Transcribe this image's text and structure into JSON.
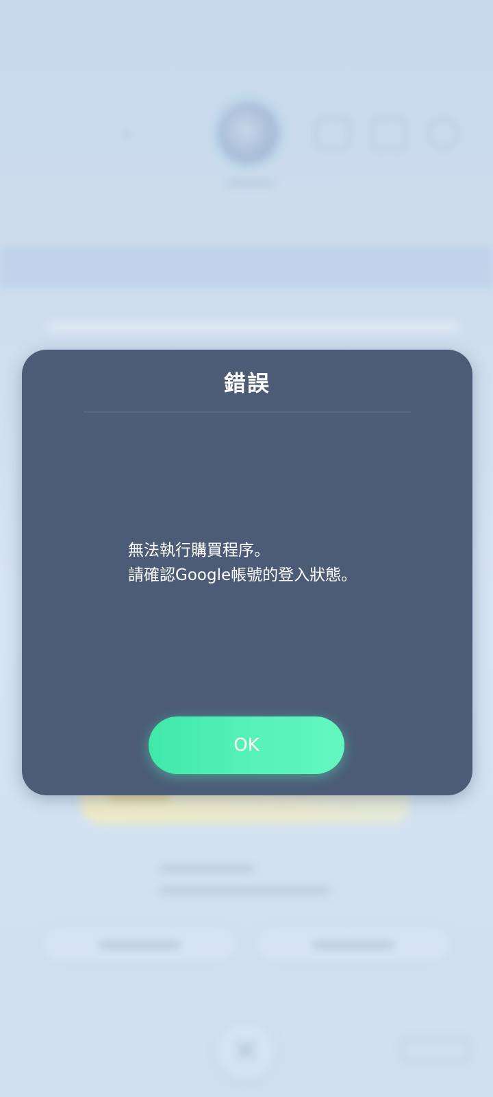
{
  "dialog": {
    "title": "錯誤",
    "message_lines": [
      "無法執行購買程序。",
      "請確認Google帳號的登入狀態。"
    ],
    "ok_label": "OK"
  },
  "background": {
    "close_glyph": "✕",
    "back_glyph": "‹"
  },
  "colors": {
    "dialog_bg": "#4c5c76",
    "ok_button": "#55f2b8",
    "backdrop": "#cfdeee"
  },
  "icons": [
    "back-icon",
    "avatar",
    "mail-icon",
    "chat-icon",
    "settings-icon",
    "close-icon"
  ]
}
